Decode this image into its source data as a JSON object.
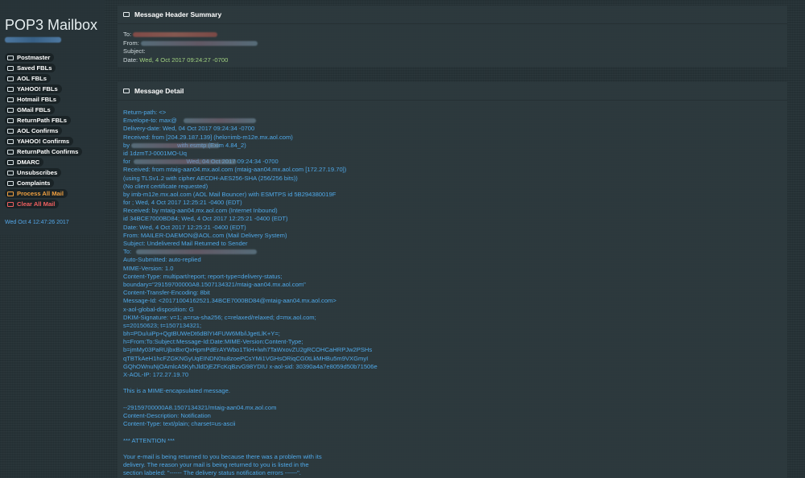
{
  "sidebar": {
    "brand": "POP3 Mailbox",
    "items": [
      {
        "label": "Postmaster",
        "style": "normal"
      },
      {
        "label": "Saved FBLs",
        "style": "normal"
      },
      {
        "label": "AOL FBLs",
        "style": "normal"
      },
      {
        "label": "YAHOO! FBLs",
        "style": "normal"
      },
      {
        "label": "Hotmail FBLs",
        "style": "normal"
      },
      {
        "label": "GMail FBLs",
        "style": "normal"
      },
      {
        "label": "ReturnPath FBLs",
        "style": "normal"
      },
      {
        "label": "AOL Confirms",
        "style": "normal"
      },
      {
        "label": "YAHOO! Confirms",
        "style": "normal"
      },
      {
        "label": "ReturnPath Confirms",
        "style": "normal"
      },
      {
        "label": "DMARC",
        "style": "normal"
      },
      {
        "label": "Unsubscribes",
        "style": "normal"
      },
      {
        "label": "Complaints",
        "style": "normal"
      },
      {
        "label": "Process All Mail",
        "style": "orange"
      },
      {
        "label": "Clear All Mail",
        "style": "red"
      }
    ],
    "timestamp": "Wed Oct 4 12:47:26 2017"
  },
  "summary": {
    "title": "Message Header Summary",
    "to_label": "To:",
    "from_label": "From:",
    "subject_label": "Subject:",
    "date_label": "Date:",
    "date_value": "Wed, 4 Oct 2017 09:24:27 -0700"
  },
  "detail": {
    "title": "Message Detail",
    "lines": [
      "Return-path: <>",
      "Envelope-to: max@",
      "Delivery-date: Wed, 04 Oct 2017 09:24:34 -0700",
      "Received: from [204.29.187.139] (helo=imb-m12e.mx.aol.com)",
      "by                            with esmtp (Exim 4.84_2)",
      "id 1dzmTJ-0001MO-Uq",
      "for                                 Wed, 04 Oct 2017 09:24:34 -0700",
      "Received: from mtaig-aan04.mx.aol.com (mtaig-aan04.mx.aol.com [172.27.19.70])",
      "(using TLSv1.2 with cipher AECDH-AES256-SHA (256/256 bits))",
      "(No client certificate requested)",
      "by imb-m12e.mx.aol.com (AOL Mail Bouncer) with ESMTPS id 5B294380019F",
      "for ; Wed, 4 Oct 2017 12:25:21 -0400 (EDT)",
      "Received: by mtaig-aan04.mx.aol.com (Internet Inbound)",
      "id 34BCE7000BD84; Wed, 4 Oct 2017 12:25:21 -0400 (EDT)",
      "Date: Wed, 4 Oct 2017 12:25:21 -0400 (EDT)",
      "From: MAILER-DAEMON@AOL.com (Mail Delivery System)",
      "Subject: Undelivered Mail Returned to Sender",
      "To:",
      "Auto-Submitted: auto-replied",
      "MIME-Version: 1.0",
      "Content-Type: multipart/report; report-type=delivery-status;",
      "boundary=\"29159700000A8.1507134321/mtaig-aan04.mx.aol.com\"",
      "Content-Transfer-Encoding: 8bit",
      "Message-Id: <20171004162521.34BCE7000BD84@mtaig-aan04.mx.aol.com>",
      "x-aol-global-disposition: G",
      "DKIM-Signature: v=1; a=rsa-sha256; c=relaxed/relaxed; d=mx.aol.com;",
      "s=20150623; t=1507134321;",
      "bh=PDu/uiPp+QgtBUWeDt6dBlYI4FUW6Mb/iJgetLlK+Y=;",
      "h=From:To:Subject:Message-Id:Date:MIME-Version:Content-Type;",
      "b=jmMy03PaRUjbxBxrQxHpmPdErAYWbo1TkH+lwh7TaWxovZU2gRCOHCaHRPJw2PSHs",
      "qTBTkAeH1hcFZGKNGyUqEINDN0tu8zoePCsYMi1VGHsORiqCG0tLkMHBu5m9VXGmyI",
      "GQhOWnuNjOAmlcA5KyhJldDjEZFcKqBzvG98YDIU x-aol-sid: 30390a4a7e8059d50b71506e",
      "X-AOL-IP: 172.27.19.70",
      "",
      "This is a MIME-encapsulated message.",
      "",
      "--29159700000A8.1507134321/mtaig-aan04.mx.aol.com",
      "Content-Description: Notification",
      "Content-Type: text/plain; charset=us-ascii",
      "",
      "*** ATTENTION ***",
      "",
      "Your e-mail is being returned to you because there was a problem with its",
      "delivery. The reason your mail is being returned to you is listed in the",
      "section labeled: \"------ The delivery status notification errors ------\"."
    ]
  }
}
